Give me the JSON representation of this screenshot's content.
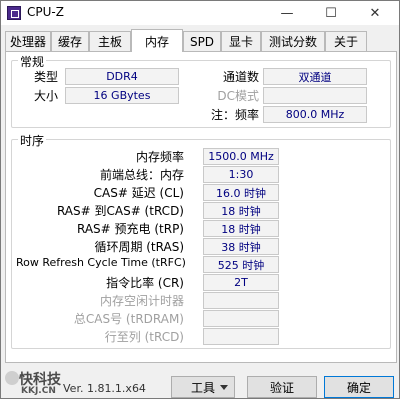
{
  "window": {
    "title": "CPU-Z",
    "minimize_symbol": "—",
    "maximize_symbol": "☐",
    "close_symbol": "✕"
  },
  "tabs": [
    {
      "label": "处理器"
    },
    {
      "label": "缓存"
    },
    {
      "label": "主板"
    },
    {
      "label": "内存",
      "active": true
    },
    {
      "label": "SPD"
    },
    {
      "label": "显卡"
    },
    {
      "label": "测试分数"
    },
    {
      "label": "关于"
    }
  ],
  "general": {
    "title": "常规",
    "type_label": "类型",
    "type_value": "DDR4",
    "size_label": "大小",
    "size_value": "16 GBytes",
    "channels_label": "通道数",
    "channels_value": "双通道",
    "dcmode_label": "DC模式",
    "dcmode_value": "",
    "nbfreq_label": "注：频率",
    "nbfreq_value": "800.0 MHz"
  },
  "timings": {
    "title": "时序",
    "rows": [
      {
        "label": "内存频率",
        "value": "1500.0 MHz",
        "enabled": true
      },
      {
        "label": "前端总线：内存",
        "value": "1:30",
        "enabled": true
      },
      {
        "label": "CAS# 延迟 (CL)",
        "value": "16.0 时钟",
        "enabled": true
      },
      {
        "label": "RAS# 到CAS# (tRCD)",
        "value": "18 时钟",
        "enabled": true
      },
      {
        "label": "RAS# 预充电 (tRP)",
        "value": "18 时钟",
        "enabled": true
      },
      {
        "label": "循环周期 (tRAS)",
        "value": "38 时钟",
        "enabled": true
      },
      {
        "label": "Row Refresh Cycle Time (tRFC)",
        "value": "525 时钟",
        "enabled": true
      },
      {
        "label": "指令比率 (CR)",
        "value": "2T",
        "enabled": true
      },
      {
        "label": "内存空闲计时器",
        "value": "",
        "enabled": false
      },
      {
        "label": "总CAS号 (tRDRAM)",
        "value": "",
        "enabled": false
      },
      {
        "label": "行至列 (tRCD)",
        "value": "",
        "enabled": false
      }
    ]
  },
  "footer": {
    "version": "Ver. 1.81.1.x64",
    "tools_label": "工具",
    "validate_label": "验证",
    "ok_label": "确定"
  },
  "watermark": {
    "text_cn": "快科技",
    "text_en": "KKJ.CN"
  }
}
